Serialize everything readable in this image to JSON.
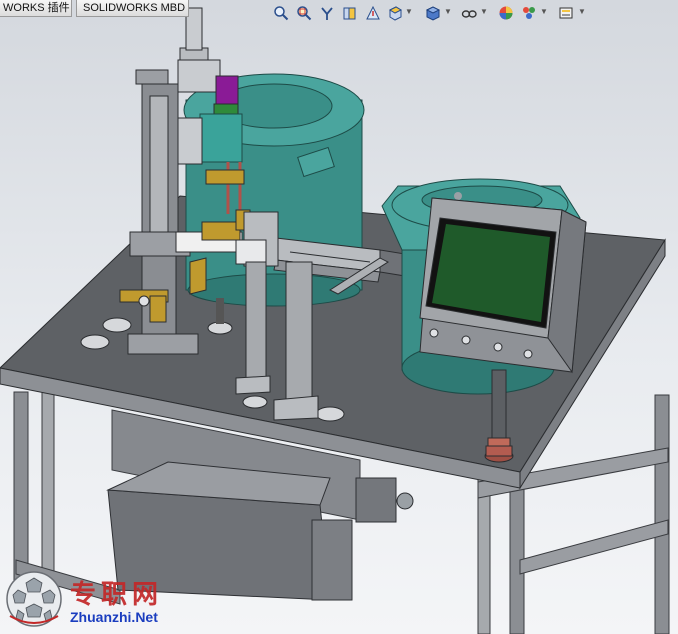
{
  "tabs": [
    {
      "label": "WORKS 插件"
    },
    {
      "label": "SOLIDWORKS MBD"
    }
  ],
  "toolbar": {
    "icons": [
      "zoom-to-fit-icon",
      "zoom-area-icon",
      "previous-view-icon",
      "section-view-icon",
      "dynamic-annotation-icon",
      "view-orientation-icon",
      "display-style-icon",
      "hide-show-items-icon",
      "edit-appearance-icon",
      "apply-scene-icon",
      "view-settings-icon"
    ]
  },
  "watermark": {
    "chinese": "专职网",
    "domain": "Zhuanzhi.Net"
  },
  "colors": {
    "table_top": "#5e6165",
    "bowl_teal": "#3f9a93",
    "screen_green": "#1f5a2a",
    "brass": "#c09a2e",
    "watermark_red": "#c32828",
    "watermark_blue": "#1a3dbf"
  }
}
